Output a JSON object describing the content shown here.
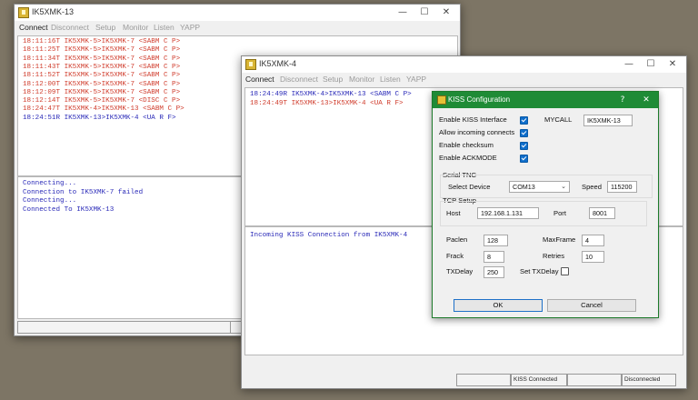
{
  "win1": {
    "title": "IK5XMK-13",
    "menu": [
      "Connect",
      "Disconnect",
      "Setup",
      "Monitor",
      "Listen",
      "YAPP"
    ],
    "monitor_lines": [
      {
        "text": "18:11:16T IK5XMK-5>IK5XMK-7 <SABM C P>",
        "color": "red"
      },
      {
        "text": "18:11:25T IK5XMK-5>IK5XMK-7 <SABM C P>",
        "color": "red"
      },
      {
        "text": "18:11:34T IK5XMK-5>IK5XMK-7 <SABM C P>",
        "color": "red"
      },
      {
        "text": "18:11:43T IK5XMK-5>IK5XMK-7 <SABM C P>",
        "color": "red"
      },
      {
        "text": "18:11:52T IK5XMK-5>IK5XMK-7 <SABM C P>",
        "color": "red"
      },
      {
        "text": "18:12:00T IK5XMK-5>IK5XMK-7 <SABM C P>",
        "color": "red"
      },
      {
        "text": "18:12:09T IK5XMK-5>IK5XMK-7 <SABM C P>",
        "color": "red"
      },
      {
        "text": "18:12:14T IK5XMK-5>IK5XMK-7 <DISC C P>",
        "color": "red"
      },
      {
        "text": "18:24:47T IK5XMK-4>IK5XMK-13 <SABM C P>",
        "color": "red"
      },
      {
        "text": "18:24:51R IK5XMK-13>IK5XMK-4 <UA R F>",
        "color": "blue"
      }
    ],
    "session_lines": [
      "Connecting...",
      "Connection to IK5XMK-7 failed",
      "Connecting...",
      "Connected To IK5XMK-13"
    ]
  },
  "win2": {
    "title": "IK5XMK-4",
    "menu": [
      "Connect",
      "Disconnect",
      "Setup",
      "Monitor",
      "Listen",
      "YAPP"
    ],
    "monitor_lines": [
      {
        "text": "18:24:49R IK5XMK-4>IK5XMK-13 <SABM C P>",
        "color": "blue"
      },
      {
        "text": "18:24:49T IK5XMK-13>IK5XMK-4 <UA R F>",
        "color": "red"
      }
    ],
    "session_lines": [
      "Incoming KISS Connection from IK5XMK-4"
    ],
    "status": [
      "",
      "KISS Connected",
      "",
      "Disconnected"
    ]
  },
  "dialog": {
    "title": "KISS Configuration",
    "help": "?",
    "close": "✕",
    "enable_kiss_label": "Enable KISS Interface",
    "enable_kiss": true,
    "allow_incoming_label": "Allow incoming connects",
    "allow_incoming": true,
    "enable_checksum_label": "Enable checksum",
    "enable_checksum": true,
    "enable_ackmode_label": "Enable ACKMODE",
    "enable_ackmode": true,
    "mycall_label": "MYCALL",
    "mycall": "IK5XMK-13",
    "serial_group": "Serial TNC",
    "select_device_label": "Select Device",
    "device": "COM13",
    "speed_label": "Speed",
    "speed": "115200",
    "tcp_group": "TCP Setup",
    "host_label": "Host",
    "host": "192.168.1.131",
    "port_label": "Port",
    "port": "8001",
    "paclen_label": "Paclen",
    "paclen": "128",
    "maxframe_label": "MaxFrame",
    "maxframe": "4",
    "frack_label": "Frack",
    "frack": "8",
    "retries_label": "Retries",
    "retries": "10",
    "txdelay_label": "TXDelay",
    "txdelay": "250",
    "set_txdelay_label": "Set TXDelay",
    "set_txdelay": false,
    "ok": "OK",
    "cancel": "Cancel"
  },
  "colors": {
    "red": "#d03c2c",
    "blue": "#2a2ab8",
    "dialog_title": "#1f8b36",
    "desktop": "#7d7565"
  },
  "icons": {
    "app": "app-icon",
    "minimize": "minimize-icon",
    "maximize": "maximize-icon",
    "close": "close-icon"
  }
}
